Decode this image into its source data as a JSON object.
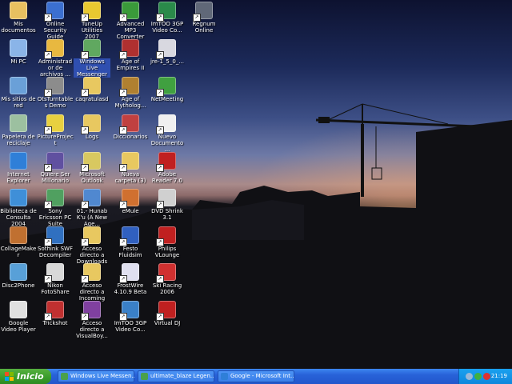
{
  "desktop_icons": [
    {
      "label": "Mis documentos",
      "icon": "folder-docs-icon",
      "color": "#e8c060"
    },
    {
      "label": "Mi PC",
      "icon": "computer-icon",
      "color": "#8ab4e8"
    },
    {
      "label": "Mis sitios de red",
      "icon": "network-icon",
      "color": "#6aa0d8"
    },
    {
      "label": "Papelera de reciclaje",
      "icon": "recycle-bin-icon",
      "color": "#9cc0a0"
    },
    {
      "label": "Internet Explorer",
      "icon": "internet-explorer-icon",
      "color": "#2f7fd8"
    },
    {
      "label": "Biblioteca de Consulta 2004",
      "icon": "library-icon",
      "color": "#3f8fd8"
    },
    {
      "label": "CollageMaker",
      "icon": "collage-icon",
      "color": "#c07030"
    },
    {
      "label": "Disc2Phone",
      "icon": "disc-icon",
      "color": "#58a0d8"
    },
    {
      "label": "Google Video Player",
      "icon": "video-player-icon",
      "color": "#e0e0e0"
    },
    {
      "label": "Online Security Guide",
      "icon": "shield-icon",
      "color": "#3b6fd0"
    },
    {
      "label": "Administrador de archivos ...",
      "icon": "file-manager-icon",
      "color": "#e8b840"
    },
    {
      "label": "OtsTurntables Demo",
      "icon": "turntable-icon",
      "color": "#8c8c8c"
    },
    {
      "label": "PictureProject",
      "icon": "picture-icon",
      "color": "#e8d040"
    },
    {
      "label": "Quiere Ser Millonario",
      "icon": "quiz-icon",
      "color": "#6050a0"
    },
    {
      "label": "Sony Ericsson PC Suite",
      "icon": "phone-icon",
      "color": "#50a060"
    },
    {
      "label": "Sothink SWF Decompiler",
      "icon": "swf-icon",
      "color": "#3070c0"
    },
    {
      "label": "Nikon FotoShare",
      "icon": "camera-icon",
      "color": "#d8d8d8"
    },
    {
      "label": "Trickshot",
      "icon": "trickshot-icon",
      "color": "#c03030"
    },
    {
      "label": "TuneUp Utilities 2007",
      "icon": "tuneup-icon",
      "color": "#e8c830"
    },
    {
      "label": "Windows Live Messenger",
      "icon": "messenger-icon",
      "color": "#60a860"
    },
    {
      "label": "caqratulasd",
      "icon": "folder-icon",
      "color": "#e8c860"
    },
    {
      "label": "Logs",
      "icon": "folder-icon",
      "color": "#e8c860"
    },
    {
      "label": "Microsoft Outlook",
      "icon": "outlook-icon",
      "color": "#d8c860"
    },
    {
      "label": "01.- Hunab K'u (A New Age...",
      "icon": "audio-file-icon",
      "color": "#5088d0"
    },
    {
      "label": "Acceso directo a Downloads",
      "icon": "folder-icon",
      "color": "#e8c860"
    },
    {
      "label": "Acceso directo a Incoming",
      "icon": "folder-icon",
      "color": "#e8c860"
    },
    {
      "label": "Acceso directo a VisualBoy...",
      "icon": "gameboy-icon",
      "color": "#8040a0"
    },
    {
      "label": "Advanced MP3 Converter",
      "icon": "mp3-converter-icon",
      "color": "#3a9a3a"
    },
    {
      "label": "Age of Empires II",
      "icon": "age-of-empires-icon",
      "color": "#b03030"
    },
    {
      "label": "Age of Mytholog...",
      "icon": "age-of-mythology-icon",
      "color": "#b08030"
    },
    {
      "label": "Diccionarios",
      "icon": "dictionary-icon",
      "color": "#c04040"
    },
    {
      "label": "Nueva carpeta (3)",
      "icon": "folder-icon",
      "color": "#e8c860"
    },
    {
      "label": "eMule",
      "icon": "emule-icon",
      "color": "#d07030"
    },
    {
      "label": "Festo Fluidsim",
      "icon": "fluidsim-icon",
      "color": "#3060c0"
    },
    {
      "label": "FrostWire 4.10.9 Beta",
      "icon": "frostwire-icon",
      "color": "#e0e0f0"
    },
    {
      "label": "ImTOO 3GP Video Co...",
      "icon": "video-converter-icon",
      "color": "#3a80c8"
    },
    {
      "label": "ImTOO 3GP Video Co...",
      "icon": "video-converter-icon",
      "color": "#2a8a4a"
    },
    {
      "label": "jre-1_5_0_...",
      "icon": "java-installer-icon",
      "color": "#d8d8e0"
    },
    {
      "label": "NetMeeting",
      "icon": "netmeeting-icon",
      "color": "#40a040"
    },
    {
      "label": "Nuevo Documento ...",
      "icon": "document-icon",
      "color": "#f0f0f0"
    },
    {
      "label": "Adobe Reader 7.0",
      "icon": "adobe-reader-icon",
      "color": "#c02020"
    },
    {
      "label": "DVD Shrink 3.1",
      "icon": "dvd-icon",
      "color": "#d0d0d0"
    },
    {
      "label": "Philips VLounge",
      "icon": "vlounge-icon",
      "color": "#c02020"
    },
    {
      "label": "Ski Racing 2006",
      "icon": "ski-racing-icon",
      "color": "#d03030"
    },
    {
      "label": "Virtual DJ",
      "icon": "virtual-dj-icon",
      "color": "#c02020"
    },
    {
      "label": "Regnum Online",
      "icon": "regnum-icon",
      "color": "#606878"
    }
  ],
  "taskbar": {
    "start_label": "Inicio",
    "tasks": [
      {
        "label": "Windows Live Messen...",
        "icon": "messenger-icon",
        "color": "#4aa04a"
      },
      {
        "label": "ultimate_blaze Legen...",
        "icon": "messenger-icon",
        "color": "#4aa04a"
      },
      {
        "label": "Google - Microsoft Int...",
        "icon": "internet-explorer-icon",
        "color": "#2f7fd8"
      }
    ],
    "tray_icons": [
      {
        "icon": "network-tray-icon",
        "color": "#9ab8d8"
      },
      {
        "icon": "messenger-tray-icon",
        "color": "#40b040"
      },
      {
        "icon": "antivirus-tray-icon",
        "color": "#e03030"
      }
    ],
    "clock": "21:19"
  },
  "colors": {
    "taskbar": "#2459d4",
    "start": "#389b2a",
    "tray": "#0f87dd"
  }
}
